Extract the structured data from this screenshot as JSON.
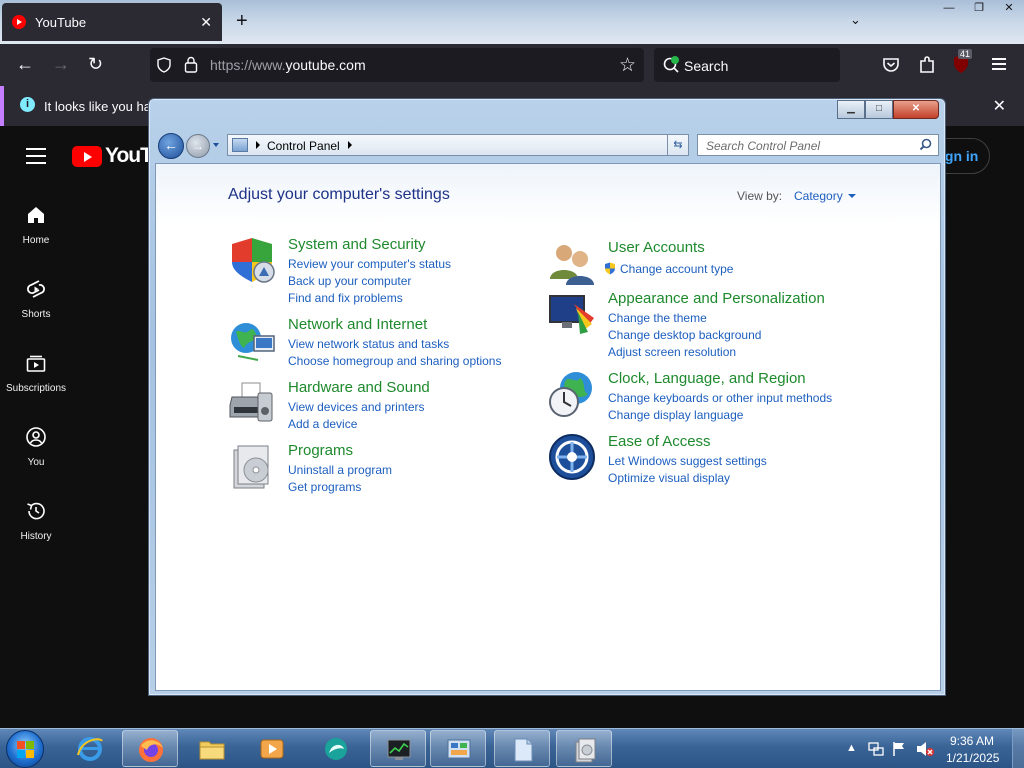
{
  "firefox": {
    "tab_title": "YouTube",
    "tab_close": "✕",
    "new_tab": "+",
    "tab_list": "⌄",
    "win_min": "—",
    "win_max": "❐",
    "win_close": "✕",
    "url_scheme": "https://www.",
    "url_host": "youtube.com",
    "search_label": "Search",
    "ext_badge": "41",
    "notification_text": "It looks like you hav",
    "notification_close": "✕"
  },
  "youtube": {
    "logo_text": "YouTu",
    "sign_in": "ign in",
    "nav": [
      {
        "label": "Home",
        "icon": "home-icon"
      },
      {
        "label": "Shorts",
        "icon": "shorts-icon"
      },
      {
        "label": "Subscriptions",
        "icon": "subscriptions-icon"
      },
      {
        "label": "You",
        "icon": "you-icon"
      },
      {
        "label": "History",
        "icon": "history-icon"
      }
    ]
  },
  "control_panel": {
    "breadcrumb": "Control Panel",
    "search_placeholder": "Search Control Panel",
    "title": "Adjust your computer's settings",
    "view_by_label": "View by:",
    "view_by_value": "Category",
    "categories": [
      {
        "title": "System and Security",
        "icon": "shield-icon",
        "links": [
          "Review your computer's status",
          "Back up your computer",
          "Find and fix problems"
        ]
      },
      {
        "title": "Network and Internet",
        "icon": "network-icon",
        "links": [
          "View network status and tasks",
          "Choose homegroup and sharing options"
        ]
      },
      {
        "title": "Hardware and Sound",
        "icon": "printer-icon",
        "links": [
          "View devices and printers",
          "Add a device"
        ]
      },
      {
        "title": "Programs",
        "icon": "programs-icon",
        "links": [
          "Uninstall a program",
          "Get programs"
        ]
      },
      {
        "title": "User Accounts",
        "icon": "users-icon",
        "links": [
          "Change account type"
        ]
      },
      {
        "title": "Appearance and Personalization",
        "icon": "appearance-icon",
        "links": [
          "Change the theme",
          "Change desktop background",
          "Adjust screen resolution"
        ]
      },
      {
        "title": "Clock, Language, and Region",
        "icon": "clock-globe-icon",
        "links": [
          "Change keyboards or other input methods",
          "Change display language"
        ]
      },
      {
        "title": "Ease of Access",
        "icon": "ease-of-access-icon",
        "links": [
          "Let Windows suggest settings",
          "Optimize visual display"
        ]
      }
    ]
  },
  "taskbar": {
    "time": "9:36 AM",
    "date": "1/21/2025",
    "tray_arrow": "▲"
  }
}
